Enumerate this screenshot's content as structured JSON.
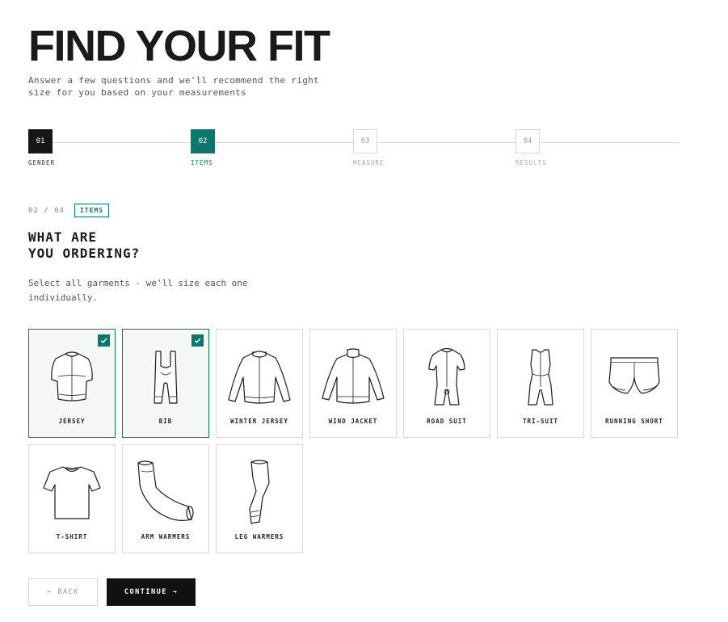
{
  "header": {
    "title": "FIND YOUR FIT",
    "subtitle": "Answer a few questions and we'll recommend the right size for you based on your measurements"
  },
  "steps": [
    {
      "num": "01",
      "label": "GENDER",
      "state": "done"
    },
    {
      "num": "02",
      "label": "ITEMS",
      "state": "active"
    },
    {
      "num": "03",
      "label": "MEASURE",
      "state": "upcoming"
    },
    {
      "num": "04",
      "label": "RESULTS",
      "state": "upcoming"
    }
  ],
  "question": {
    "counter": "02 / 04",
    "badge": "ITEMS",
    "title_line1": "WHAT ARE",
    "title_line2": "YOU ORDERING?",
    "description": "Select all garments - we'll size each one individually."
  },
  "garments": [
    {
      "label": "JERSEY",
      "icon": "jersey-icon",
      "selected": true
    },
    {
      "label": "BIB",
      "icon": "bib-icon",
      "selected": true
    },
    {
      "label": "WINTER JERSEY",
      "icon": "winter-jersey-icon",
      "selected": false
    },
    {
      "label": "WIND JACKET",
      "icon": "wind-jacket-icon",
      "selected": false
    },
    {
      "label": "ROAD SUIT",
      "icon": "road-suit-icon",
      "selected": false
    },
    {
      "label": "TRI-SUIT",
      "icon": "tri-suit-icon",
      "selected": false
    },
    {
      "label": "RUNNING SHORT",
      "icon": "running-short-icon",
      "selected": false
    },
    {
      "label": "T-SHIRT",
      "icon": "t-shirt-icon",
      "selected": false
    },
    {
      "label": "ARM WARMERS",
      "icon": "arm-warmers-icon",
      "selected": false
    },
    {
      "label": "LEG WARMERS",
      "icon": "leg-warmers-icon",
      "selected": false
    }
  ],
  "actions": {
    "back": "← BACK",
    "continue": "CONTINUE →"
  },
  "colors": {
    "accent": "#0f766e",
    "dark": "#111111"
  }
}
